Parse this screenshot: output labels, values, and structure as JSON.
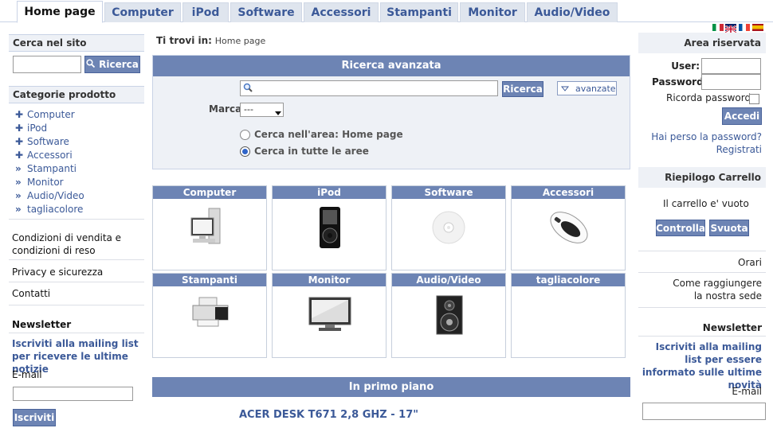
{
  "tabs": [
    {
      "label": "Home page",
      "active": true
    },
    {
      "label": "Computer"
    },
    {
      "label": "iPod"
    },
    {
      "label": "Software"
    },
    {
      "label": "Accessori"
    },
    {
      "label": "Stampanti"
    },
    {
      "label": "Monitor"
    },
    {
      "label": "Audio/Video"
    }
  ],
  "languages": [
    "italiano",
    "english",
    "français",
    "español"
  ],
  "left": {
    "search_title": "Cerca nel sito",
    "search_button": "Ricerca",
    "search_value": "",
    "categories_title": "Categorie prodotto",
    "categories": [
      {
        "label": "Computer",
        "icon": "plus-icon"
      },
      {
        "label": "iPod",
        "icon": "plus-icon"
      },
      {
        "label": "Software",
        "icon": "plus-icon"
      },
      {
        "label": "Accessori",
        "icon": "plus-icon"
      },
      {
        "label": "Stampanti",
        "icon": "double-chevron-icon"
      },
      {
        "label": "Monitor",
        "icon": "double-chevron-icon"
      },
      {
        "label": "Audio/Video",
        "icon": "double-chevron-icon"
      },
      {
        "label": "tagliacolore",
        "icon": "double-chevron-icon"
      }
    ],
    "links": [
      "Condizioni di vendita e condizioni di reso",
      "Privacy e sicurezza",
      "Contatti"
    ],
    "newsletter_title": "Newsletter",
    "newsletter_text": "Iscriviti alla mailing list per ricevere le ultime notizie",
    "email_label": "E-mail",
    "subscribe_button": "Iscriviti"
  },
  "center": {
    "breadcrumb_label": "Ti trovi in:",
    "breadcrumb_value": "Home page",
    "advanced_title": "Ricerca avanzata",
    "search_button": "Ricerca",
    "advanced_toggle": "avanzate",
    "brand_label": "Marca",
    "brand_selected": "---",
    "radio_area": "Cerca nell'area: Home page",
    "radio_all": "Cerca in tutte le aree",
    "categories": [
      {
        "label": "Computer",
        "image": "computer"
      },
      {
        "label": "iPod",
        "image": "ipod"
      },
      {
        "label": "Software",
        "image": "disc"
      },
      {
        "label": "Accessori",
        "image": "mouse"
      },
      {
        "label": "Stampanti",
        "image": "printer"
      },
      {
        "label": "Monitor",
        "image": "monitor"
      },
      {
        "label": "Audio/Video",
        "image": "speaker"
      },
      {
        "label": "tagliacolore",
        "image": ""
      }
    ],
    "featured_title": "In primo piano",
    "featured_product": "ACER DESK T671 2,8 GHZ - 17\""
  },
  "right": {
    "login_title": "Area riservata",
    "user_label": "User:",
    "password_label": "Password:",
    "remember_label": "Ricorda password",
    "login_button": "Accedi",
    "lost_password": "Hai perso la password?",
    "register": "Registrati",
    "cart_title": "Riepilogo Carrello",
    "cart_empty": "Il carrello e' vuoto",
    "cart_check": "Controlla",
    "cart_empty_button": "Svuota",
    "hours": "Orari",
    "directions": "Come raggiungere la nostra sede",
    "newsletter_title": "Newsletter",
    "newsletter_text": "Iscriviti alla mailing list per essere informato sulle ultime novità",
    "email_label": "E-mail"
  },
  "colors": {
    "accent": "#6d84b4",
    "link": "#3b5998",
    "header_bg": "#eef1f6"
  }
}
